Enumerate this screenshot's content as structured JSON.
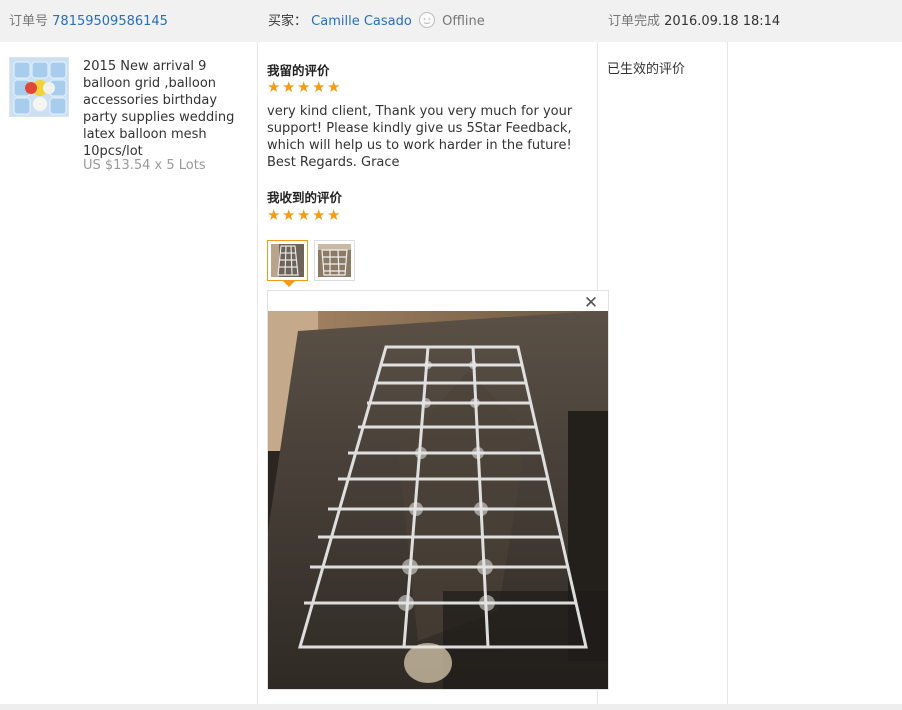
{
  "order": {
    "number_label": "订单号",
    "number": "78159509586145",
    "buyer_label": "买家：",
    "buyer_name": "Camille Casado",
    "buyer_status": "Offline",
    "complete_label": "订单完成",
    "complete_time": "2016.09.18 18:14"
  },
  "product": {
    "title": "2015 New arrival 9 balloon grid ,balloon accessories birthday party supplies wedding latex balloon mesh 10pcs/lot",
    "price": "US $13.54 x 5 Lots"
  },
  "feedback": {
    "left_heading": "我留的评价",
    "left_stars": 5,
    "left_text": "very kind client, Thank you very much for your support! Please kindly give us 5Star Feedback, which will help us to work harder in the future! Best Regards. Grace",
    "received_heading": "我收到的评价",
    "received_stars": 5,
    "close_symbol": "✕"
  },
  "status_text": "已生效的评价",
  "colors": {
    "link": "#2a6eb8",
    "star": "#f39a1a",
    "header_bg": "#f1f1f1"
  }
}
